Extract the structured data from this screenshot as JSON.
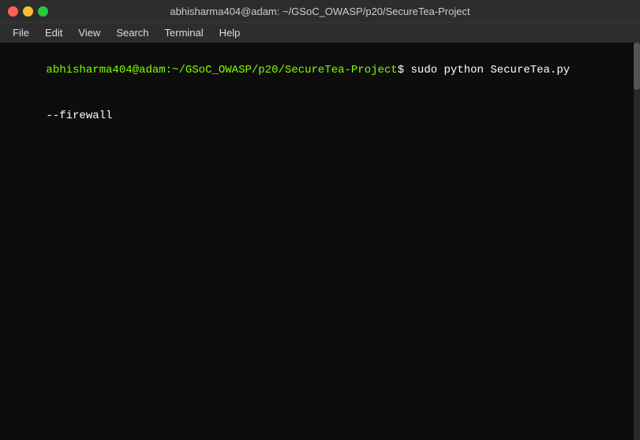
{
  "titlebar": {
    "title": "abhisharma404@adam: ~/GSoC_OWASP/p20/SecureTea-Project"
  },
  "menubar": {
    "items": [
      {
        "label": "File"
      },
      {
        "label": "Edit"
      },
      {
        "label": "View"
      },
      {
        "label": "Search"
      },
      {
        "label": "Terminal"
      },
      {
        "label": "Help"
      }
    ]
  },
  "terminal": {
    "prompt_user": "abhisharma404@adam",
    "prompt_path": ":~/GSoC_OWASP/p20/SecureTea-Project",
    "prompt_symbol": "$",
    "command": " sudo python SecureTea.py",
    "output_line1": "--firewall"
  },
  "colors": {
    "close": "#ff5f56",
    "minimize": "#ffbd2e",
    "maximize": "#27c93f"
  }
}
